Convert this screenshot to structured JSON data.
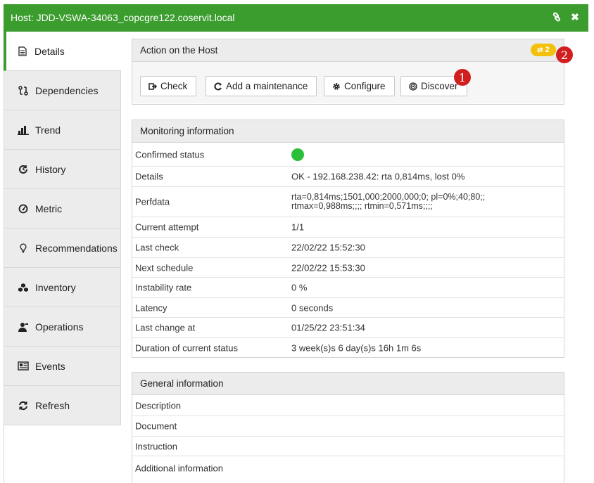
{
  "window": {
    "title": "Host: JDD-VSWA-34063_copcgre122.coservit.local",
    "link_icon": "link-icon",
    "close_icon": "close-icon"
  },
  "sidebar": {
    "items": [
      {
        "label": "Details",
        "icon": "document-icon",
        "active": true
      },
      {
        "label": "Dependencies",
        "icon": "dependencies-icon",
        "active": false
      },
      {
        "label": "Trend",
        "icon": "bar-chart-icon",
        "active": false
      },
      {
        "label": "History",
        "icon": "history-icon",
        "active": false
      },
      {
        "label": "Metric",
        "icon": "gauge-icon",
        "active": false
      },
      {
        "label": "Recommendations",
        "icon": "lightbulb-icon",
        "active": false
      },
      {
        "label": "Inventory",
        "icon": "cubes-icon",
        "active": false
      },
      {
        "label": "Operations",
        "icon": "operator-icon",
        "active": false
      },
      {
        "label": "Events",
        "icon": "newspaper-icon",
        "active": false
      },
      {
        "label": "Refresh",
        "icon": "refresh-icon",
        "active": false
      }
    ]
  },
  "actions": {
    "title": "Action on the Host",
    "badge": "2",
    "buttons": [
      {
        "label": "Check",
        "icon": "check-run-icon"
      },
      {
        "label": "Add a maintenance",
        "icon": "maintenance-icon"
      },
      {
        "label": "Configure",
        "icon": "gear-icon"
      },
      {
        "label": "Discover",
        "icon": "discover-icon"
      }
    ]
  },
  "markers": {
    "one": "1",
    "two": "2"
  },
  "monitoring": {
    "title": "Monitoring information",
    "status_color": "#2bbf3a",
    "rows": [
      {
        "key": "Confirmed status",
        "value": ""
      },
      {
        "key": "Details",
        "value": "OK - 192.168.238.42: rta 0,814ms, lost 0%"
      },
      {
        "key": "Perfdata",
        "value": "rta=0,814ms;1501,000;2000,000;0; pl=0%;40;80;;",
        "value2": "rtmax=0,988ms;;;; rtmin=0,571ms;;;;"
      },
      {
        "key": "Current attempt",
        "value": "1/1"
      },
      {
        "key": "Last check",
        "value": "22/02/22 15:52:30"
      },
      {
        "key": "Next schedule",
        "value": "22/02/22 15:53:30"
      },
      {
        "key": "Instability rate",
        "value": "0 %"
      },
      {
        "key": "Latency",
        "value": "0 seconds"
      },
      {
        "key": "Last change at",
        "value": "01/25/22 23:51:34"
      },
      {
        "key": "Duration of current status",
        "value": "3 week(s)s 6 day(s)s 16h 1m 6s"
      }
    ]
  },
  "general": {
    "title": "General information",
    "rows": [
      {
        "key": "Description"
      },
      {
        "key": "Document"
      },
      {
        "key": "Instruction"
      },
      {
        "key": "Additional information"
      }
    ]
  }
}
